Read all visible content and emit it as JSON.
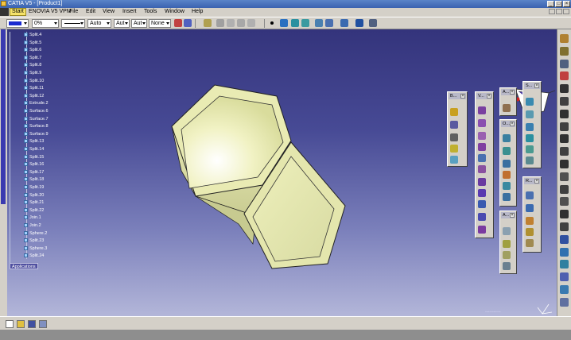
{
  "window": {
    "title": "CATIA V5 - [Product1]"
  },
  "menu": {
    "items": [
      "Start",
      "ENOVIA V5 VPM",
      "File",
      "Edit",
      "View",
      "Insert",
      "Tools",
      "Window",
      "Help"
    ]
  },
  "toolbar": {
    "color_value": "",
    "transparency_value": "0%",
    "line_type_value": "",
    "line_weight_value": "Auto",
    "point_value": "Aut",
    "layer_value": "Aut",
    "render_value": "None"
  },
  "tree": {
    "items": [
      "Split.4",
      "Split.5",
      "Split.6",
      "Split.7",
      "Split.8",
      "Split.9",
      "Split.10",
      "Split.11",
      "Split.12",
      "Extrude.2",
      "Surface.6",
      "Surface.7",
      "Surface.8",
      "Surface.9",
      "Split.13",
      "Split.14",
      "Split.15",
      "Split.16",
      "Split.17",
      "Split.18",
      "Split.19",
      "Split.20",
      "Split.21",
      "Split.22",
      "Join.1",
      "Join.2",
      "Sphere.2",
      "Split.23",
      "Sphere.3",
      "Split.24"
    ],
    "applications_label": "Applications"
  },
  "panels": {
    "p1": "B...",
    "p2": "V...",
    "p3": "A...",
    "p4": "O...",
    "p5": "A...",
    "p6": "S...",
    "p7": "R..."
  },
  "colors": {
    "viewport_top": "#34347c",
    "viewport_bottom": "#b3b6d9",
    "surface_light": "#f7f7d2",
    "surface_mid": "#e6e8a8",
    "surface_edge": "#b5b981",
    "edge": "#202030"
  }
}
